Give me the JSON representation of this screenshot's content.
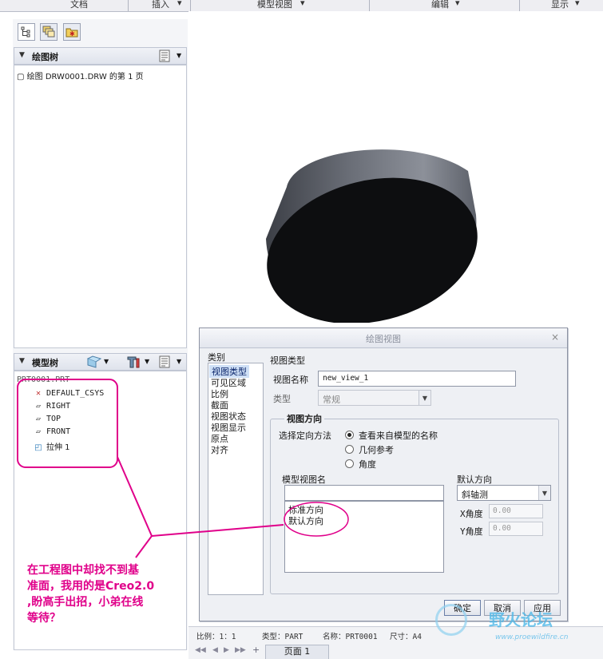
{
  "menubar": {
    "items": [
      "文档",
      "插入",
      "模型视图",
      "编辑",
      "显示"
    ]
  },
  "tabs": {
    "icons": [
      "tree-icon",
      "layers-icon",
      "folder-star-icon"
    ]
  },
  "drawing_tree": {
    "title": "绘图树",
    "item": "绘图 DRW0001.DRW 的第 1 页"
  },
  "model_tree": {
    "title": "模型树",
    "root": "PRT0001.PRT",
    "items": [
      "DEFAULT_CSYS",
      "RIGHT",
      "TOP",
      "FRONT",
      "拉伸 1"
    ]
  },
  "dialog": {
    "title": "绘图视图",
    "close": "×",
    "category_label": "类别",
    "categories": [
      "视图类型",
      "可见区域",
      "比例",
      "截面",
      "视图状态",
      "视图显示",
      "原点",
      "对齐"
    ],
    "section_title": "视图类型",
    "view_name_label": "视图名称",
    "view_name_value": "new_view_1",
    "type_label": "类型",
    "type_value": "常规",
    "orientation_title": "视图方向",
    "orient_method_label": "选择定向方法",
    "orient_options": [
      "查看来自模型的名称",
      "几何参考",
      "角度"
    ],
    "model_view_label": "模型视图名",
    "model_views": [
      "标准方向",
      "默认方向"
    ],
    "default_orient_label": "默认方向",
    "default_orient_value": "斜轴测",
    "x_angle_label": "X角度",
    "x_angle_value": "0.00",
    "y_angle_label": "Y角度",
    "y_angle_value": "0.00",
    "ok": "确定",
    "cancel": "取消",
    "apply": "应用"
  },
  "status": {
    "scale": "比例：1：1",
    "type": "类型：PART",
    "name": "名称：PRT0001",
    "size": "尺寸：A4",
    "page_tab": "页面 1"
  },
  "annotation": {
    "line1": "在工程图中却找不到基",
    "line2": "准面，我用的是Creo2.0",
    "line3": ",盼高手出招，小弟在线",
    "line4": "等待？"
  },
  "watermark": {
    "brand": "野火论坛",
    "url": "www.proewildfire.cn"
  },
  "colors": {
    "annotation": "#e0008a",
    "selection": "#cfe0f6",
    "watermark": "#4fb8e8"
  }
}
